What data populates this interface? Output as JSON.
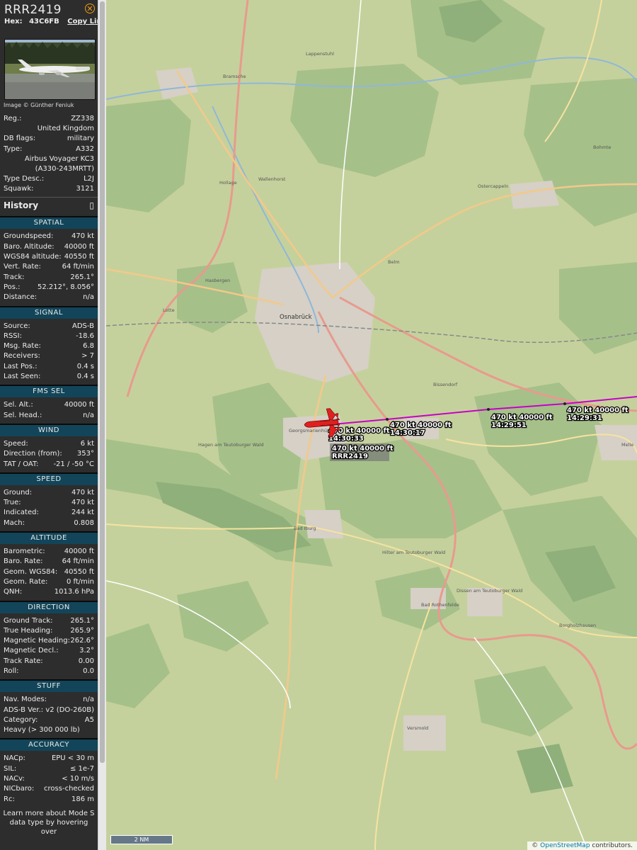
{
  "header": {
    "callsign": "RRR2419",
    "hex_label": "Hex:",
    "hex": "43C6FB",
    "copy_link": "Copy Link"
  },
  "photo_credit": "Image © Günther Feniuk",
  "info": {
    "reg_label": "Reg.:",
    "reg": "ZZ338",
    "country": "United Kingdom",
    "dbflags_label": "DB flags:",
    "dbflags": "military",
    "type_label": "Type:",
    "type": "A332",
    "type_name": "Airbus Voyager KC3",
    "type_variant": "(A330-243MRTT)",
    "typedesc_label": "Type Desc.:",
    "typedesc": "L2J",
    "squawk_label": "Squawk:",
    "squawk": "3121"
  },
  "history": {
    "label": "History",
    "icon": "expand-icon"
  },
  "sections": {
    "spatial": {
      "title": "SPATIAL",
      "rows": [
        {
          "k": "Groundspeed:",
          "v": "470 kt"
        },
        {
          "k": "Baro. Altitude:",
          "v": "40000 ft"
        },
        {
          "k": "WGS84 altitude:",
          "v": "40550 ft"
        },
        {
          "k": "Vert. Rate:",
          "v": "64 ft/min"
        },
        {
          "k": "Track:",
          "v": "265.1°"
        },
        {
          "k": "Pos.:",
          "v": "52.212°, 8.056°"
        },
        {
          "k": "Distance:",
          "v": "n/a"
        }
      ]
    },
    "signal": {
      "title": "SIGNAL",
      "rows": [
        {
          "k": "Source:",
          "v": "ADS-B"
        },
        {
          "k": "RSSI:",
          "v": "-18.6"
        },
        {
          "k": "Msg. Rate:",
          "v": "6.8"
        },
        {
          "k": "Receivers:",
          "v": "> 7"
        },
        {
          "k": "Last Pos.:",
          "v": "0.4 s"
        },
        {
          "k": "Last Seen:",
          "v": "0.4 s"
        }
      ]
    },
    "fms": {
      "title": "FMS SEL",
      "rows": [
        {
          "k": "Sel. Alt.:",
          "v": "40000 ft"
        },
        {
          "k": "Sel. Head.:",
          "v": "n/a"
        }
      ]
    },
    "wind": {
      "title": "WIND",
      "rows": [
        {
          "k": "Speed:",
          "v": "6 kt"
        },
        {
          "k": "Direction (from):",
          "v": "353°"
        },
        {
          "k": "TAT / OAT:",
          "v": "-21 / -50 °C"
        }
      ]
    },
    "speed": {
      "title": "SPEED",
      "rows": [
        {
          "k": "Ground:",
          "v": "470 kt"
        },
        {
          "k": "True:",
          "v": "470 kt"
        },
        {
          "k": "Indicated:",
          "v": "244 kt"
        },
        {
          "k": "Mach:",
          "v": "0.808"
        }
      ]
    },
    "altitude": {
      "title": "ALTITUDE",
      "rows": [
        {
          "k": "Barometric:",
          "v": "40000 ft"
        },
        {
          "k": "Baro. Rate:",
          "v": "64 ft/min"
        },
        {
          "k": "Geom. WGS84:",
          "v": "40550 ft"
        },
        {
          "k": "Geom. Rate:",
          "v": "0 ft/min"
        },
        {
          "k": "QNH:",
          "v": "1013.6 hPa"
        }
      ]
    },
    "direction": {
      "title": "DIRECTION",
      "rows": [
        {
          "k": "Ground Track:",
          "v": "265.1°"
        },
        {
          "k": "True Heading:",
          "v": "265.9°"
        },
        {
          "k": "Magnetic Heading:",
          "v": "262.6°"
        },
        {
          "k": "Magnetic Decl.:",
          "v": "3.2°"
        },
        {
          "k": "Track Rate:",
          "v": "0.00"
        },
        {
          "k": "Roll:",
          "v": "0.0"
        }
      ]
    },
    "stuff": {
      "title": "STUFF",
      "rows": [
        {
          "k": "Nav. Modes:",
          "v": "n/a"
        },
        {
          "k": "ADS-B Ver.:",
          "v": "v2 (DO-260B)"
        },
        {
          "k": "Category:",
          "v": "A5"
        }
      ],
      "category_desc": "Heavy (> 300 000 lb)"
    },
    "accuracy": {
      "title": "ACCURACY",
      "rows": [
        {
          "k": "NACp:",
          "v": "EPU < 30 m"
        },
        {
          "k": "SIL:",
          "v": "≤ 1e-7"
        },
        {
          "k": "NACv:",
          "v": "< 10 m/s"
        },
        {
          "k": "NICbaro:",
          "v": "cross-checked"
        },
        {
          "k": "Rc:",
          "v": "186 m"
        }
      ]
    }
  },
  "footer": "Learn more about Mode S data type by hovering over",
  "map": {
    "track_color": "#c800c8",
    "aircraft_color": "#e02020",
    "aircraft_label": {
      "speed_alt": "470 kt  40000 ft",
      "callsign": "RRR2419"
    },
    "track_labels": [
      {
        "speed_alt": "470 kt  40000 ft",
        "time": "14:30:33"
      },
      {
        "speed_alt": "470 kt  40000 ft",
        "time": "14:30:17"
      },
      {
        "speed_alt": "470 kt  40000 ft",
        "time": "14:29:51"
      },
      {
        "speed_alt": "470 kt  40000 ft",
        "time": "14:29:31"
      }
    ],
    "places": [
      {
        "name": "Osnabrück",
        "big": true
      },
      {
        "name": "Georgsmarienhütte",
        "big": false
      },
      {
        "name": "Bad Iburg",
        "big": false
      },
      {
        "name": "Hilter am Teutoburger Wald",
        "big": false
      },
      {
        "name": "Dissen am Teutoburger Wald",
        "big": false
      },
      {
        "name": "Bad Rothenfelde",
        "big": false
      },
      {
        "name": "Versmold",
        "big": false
      },
      {
        "name": "Borgholzhausen",
        "big": false
      },
      {
        "name": "Hagen am Teutoburger Wald",
        "big": false
      },
      {
        "name": "Bissendorf",
        "big": false
      },
      {
        "name": "Belm",
        "big": false
      },
      {
        "name": "Wallenhorst",
        "big": false
      },
      {
        "name": "Bramsche",
        "big": false
      },
      {
        "name": "Ostercappeln",
        "big": false
      },
      {
        "name": "Melle",
        "big": false
      },
      {
        "name": "Lotte",
        "big": false
      },
      {
        "name": "Bohmte",
        "big": false
      },
      {
        "name": "Hasbergen",
        "big": false
      },
      {
        "name": "Hollage",
        "big": false
      },
      {
        "name": "Lappenstuhl",
        "big": false
      }
    ],
    "scale": "2 NM",
    "attribution_prefix": "©",
    "attribution_link": "OpenStreetMap",
    "attribution_suffix": "contributors."
  }
}
